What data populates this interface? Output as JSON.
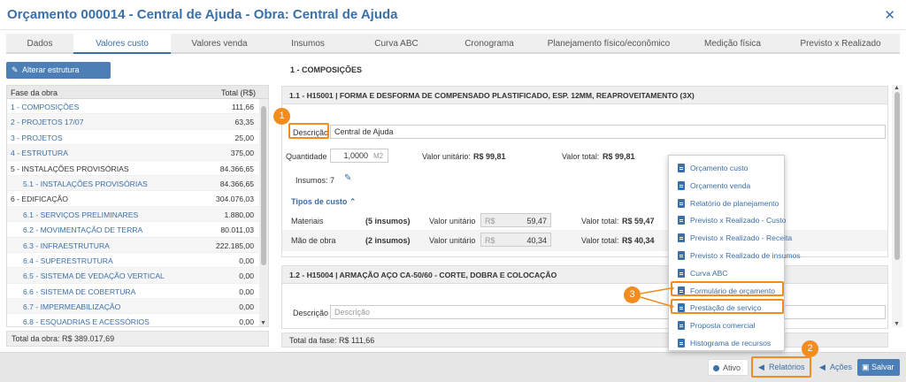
{
  "window": {
    "title": "Orçamento 000014 - Central de Ajuda - Obra: Central de Ajuda",
    "close": "✕"
  },
  "tabs": [
    "Dados",
    "Valores custo",
    "Valores venda",
    "Insumos",
    "Curva ABC",
    "Cronograma",
    "Planejamento físico/econômico",
    "Medição física",
    "Previsto x Realizado"
  ],
  "left": {
    "alterar_label": "Alterar estrutura",
    "col_fase": "Fase da obra",
    "col_total": "Total (R$)",
    "rows": [
      {
        "name": "1 - COMPOSIÇÕES",
        "value": "111,66",
        "link": true,
        "indent": false
      },
      {
        "name": "2 - PROJETOS 17/07",
        "value": "63,35",
        "link": true,
        "indent": false
      },
      {
        "name": "3 - PROJETOS",
        "value": "25,00",
        "link": true,
        "indent": false
      },
      {
        "name": "4 - ESTRUTURA",
        "value": "375,00",
        "link": true,
        "indent": false
      },
      {
        "name": "5 - INSTALAÇÕES PROVISÓRIAS",
        "value": "84.366,65",
        "link": false,
        "indent": false
      },
      {
        "name": "5.1 - INSTALAÇÕES PROVISÓRIAS",
        "value": "84.366,65",
        "link": true,
        "indent": true
      },
      {
        "name": "6 - EDIFICAÇÃO",
        "value": "304.076,03",
        "link": false,
        "indent": false
      },
      {
        "name": "6.1 - SERVIÇOS PRELIMINARES",
        "value": "1.880,00",
        "link": true,
        "indent": true
      },
      {
        "name": "6.2 - MOVIMENTAÇÃO DE TERRA",
        "value": "80.011,03",
        "link": true,
        "indent": true
      },
      {
        "name": "6.3 - INFRAESTRUTURA",
        "value": "222.185,00",
        "link": true,
        "indent": true
      },
      {
        "name": "6.4 - SUPERESTRUTURA",
        "value": "0,00",
        "link": true,
        "indent": true
      },
      {
        "name": "6.5 - SISTEMA DE VEDAÇÃO VERTICAL",
        "value": "0,00",
        "link": true,
        "indent": true
      },
      {
        "name": "6.6 - SISTEMA DE COBERTURA",
        "value": "0,00",
        "link": true,
        "indent": true
      },
      {
        "name": "6.7 - IMPERMEABILIZAÇÃO",
        "value": "0,00",
        "link": true,
        "indent": true
      },
      {
        "name": "6.8 - ESQUADRIAS E ACESSÓRIOS",
        "value": "0,00",
        "link": true,
        "indent": true
      }
    ],
    "total": "Total da obra: R$ 389.017,69"
  },
  "right": {
    "section": "1 - COMPOSIÇÕES",
    "card1": {
      "title": "1.1 - H15001 | FORMA E DESFORMA DE COMPENSADO PLASTIFICADO, ESP. 12MM, REAPROVEITAMENTO (3X)",
      "descricao_label": "Descrição",
      "descricao_value": "Central de Ajuda",
      "quantidade_label": "Quantidade",
      "quantidade_value": "1,0000",
      "quantidade_unit": "M2",
      "vu_label": "Valor unitário:",
      "vu_value": "R$ 99,81",
      "vt_label": "Valor total:",
      "vt_value": "R$ 99,81",
      "insumos_label": "Insumos:",
      "insumos_value": "7",
      "tipos_label": "Tipos de custo",
      "materiais": {
        "label": "Materiais",
        "count": "(5 insumos)",
        "vu_label": "Valor unitário",
        "prefix": "R$",
        "vu_value": "59,47",
        "vt_label": "Valor total:",
        "vt_value": "R$ 59,47"
      },
      "mao": {
        "label": "Mão de obra",
        "count": "(2 insumos)",
        "vu_label": "Valor unitário",
        "prefix": "R$",
        "vu_value": "40,34",
        "vt_label": "Valor total:",
        "vt_value": "R$ 40,34"
      }
    },
    "card2": {
      "title": "1.2 - H15004 | ARMAÇÃO AÇO CA-50/60 - CORTE, DOBRA E COLOCAÇÃO",
      "descricao_label": "Descrição",
      "descricao_placeholder": "Descrição"
    },
    "total": "Total da fase: R$ 111,66"
  },
  "menu": [
    "Orçamento custo",
    "Orçamento venda",
    "Relatório de planejamento",
    "Previsto x Realizado - Custo",
    "Previsto x Realizado - Receita",
    "Previsto x Realizado de insumos",
    "Curva ABC",
    "Formulário de orçamento",
    "Prestação de serviço",
    "Proposta comercial",
    "Histograma de recursos"
  ],
  "footer": {
    "ativo": "Ativo",
    "relatorios": "Relatórios",
    "acoes": "Ações",
    "salvar": "Salvar"
  },
  "badges": [
    "1",
    "2",
    "3"
  ],
  "colors": {
    "accent": "#3b6fa8",
    "highlight": "#f28c1e",
    "button": "#4c7fb6"
  }
}
